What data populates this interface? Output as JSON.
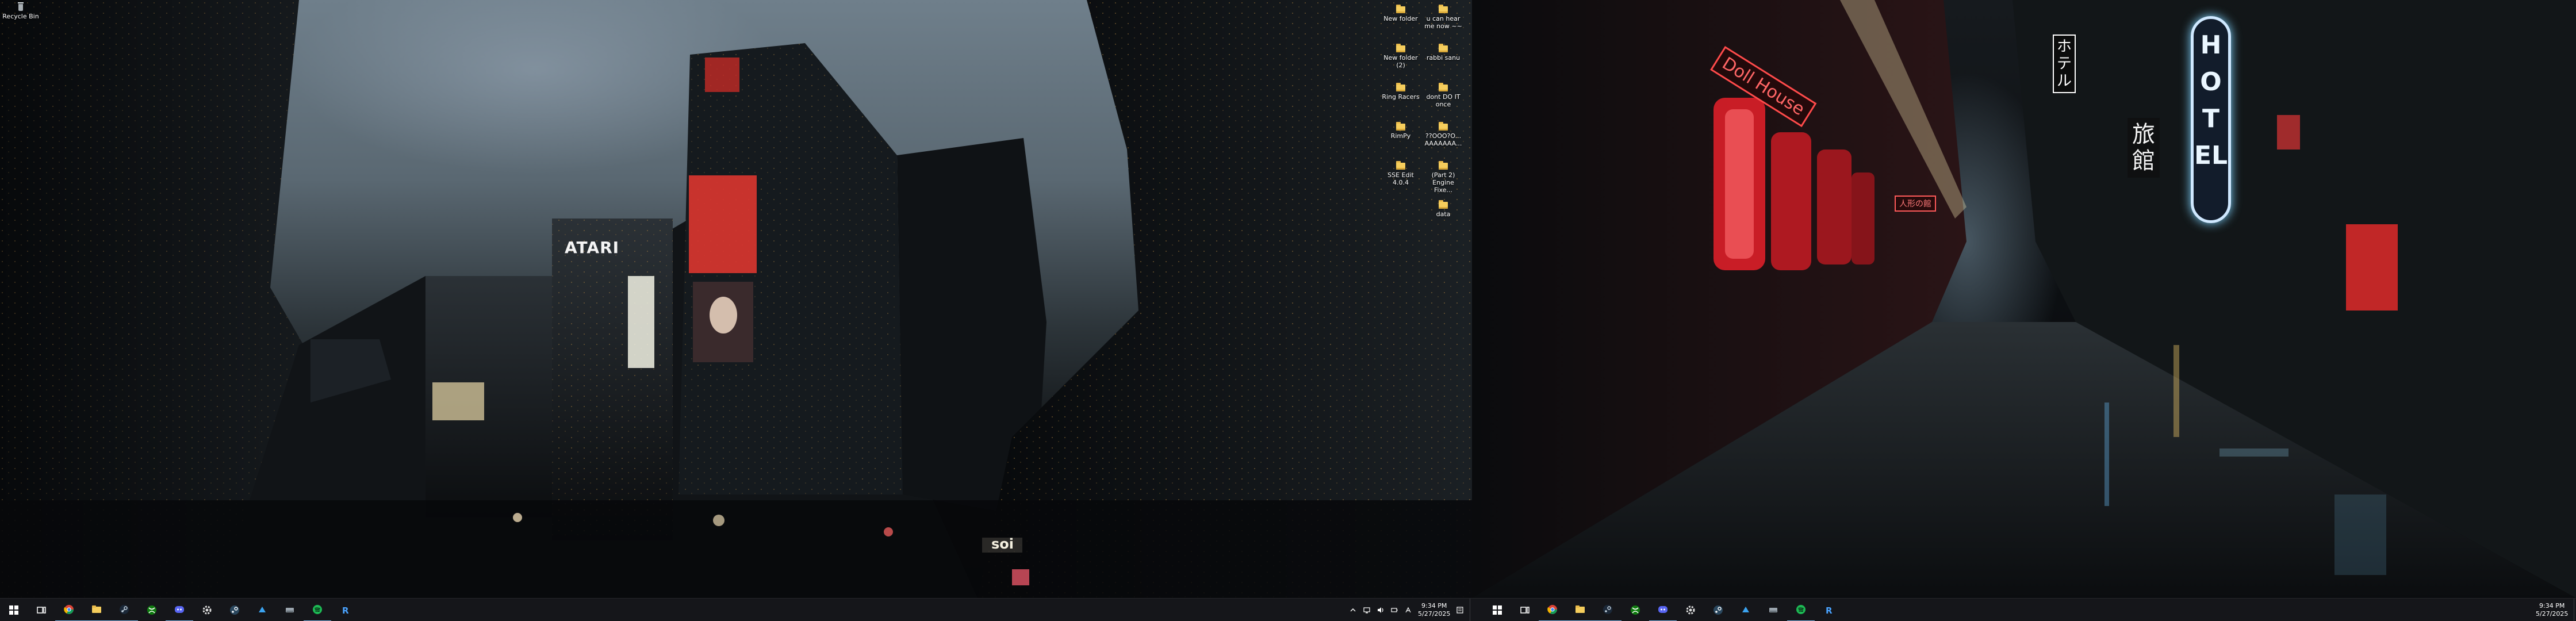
{
  "desktop_left": {
    "recycle_bin": "Recycle Bin",
    "icons": [
      {
        "label": "New folder",
        "type": "folder"
      },
      {
        "label": "u can hear me now ~~",
        "type": "folder"
      },
      {
        "label": "New folder (2)",
        "type": "folder"
      },
      {
        "label": "rabbi sanu",
        "type": "folder"
      },
      {
        "label": "Ring Racers",
        "type": "folder"
      },
      {
        "label": "dont DO IT once",
        "type": "folder"
      },
      {
        "label": "RimPy",
        "type": "folder"
      },
      {
        "label": "??OOO?O... AAAAAAA...",
        "type": "folder"
      },
      {
        "label": "SSE Edit 4.0.4",
        "type": "folder"
      },
      {
        "label": "(Part 2) Engine Fixe...",
        "type": "folder"
      },
      {
        "label": "",
        "type": "none"
      },
      {
        "label": "data",
        "type": "folder"
      }
    ]
  },
  "wallpaper_left": {
    "billboard_brand": "ATARI",
    "billboard_text": "soi"
  },
  "wallpaper_right": {
    "sign_doll_house": "Doll House",
    "sign_hotel": "HOTEL",
    "sign_hotel_jp": "ホテル",
    "sign_ryokan": "旅館",
    "sign_small": "人形の館"
  },
  "taskbar_left": {
    "apps": [
      {
        "name": "start-button",
        "icon": "windows-icon",
        "active": false
      },
      {
        "name": "task-view-button",
        "icon": "task-view-icon",
        "active": false
      },
      {
        "name": "taskbar-chrome",
        "icon": "chrome-icon",
        "active": true
      },
      {
        "name": "taskbar-file-explorer",
        "icon": "folder-icon",
        "active": true
      },
      {
        "name": "taskbar-steam",
        "icon": "steam-icon",
        "active": true
      },
      {
        "name": "taskbar-xbox",
        "icon": "xbox-icon",
        "active": false
      },
      {
        "name": "taskbar-discord",
        "icon": "discord-icon",
        "active": true
      },
      {
        "name": "taskbar-settings",
        "icon": "gear-icon",
        "active": false
      },
      {
        "name": "taskbar-steam-2",
        "icon": "steam-icon",
        "active": false
      },
      {
        "name": "taskbar-app-blue",
        "icon": "app-icon",
        "active": false
      },
      {
        "name": "taskbar-app-drive",
        "icon": "drive-icon",
        "active": false
      },
      {
        "name": "taskbar-spotify",
        "icon": "spotify-icon",
        "active": true
      },
      {
        "name": "taskbar-app-r",
        "icon": "r-icon",
        "active": false
      }
    ],
    "tray_icons": [
      "chevron-up-icon",
      "network-icon",
      "volume-icon",
      "battery-icon",
      "language-icon"
    ],
    "time": "9:34 PM",
    "date": "5/27/2025"
  },
  "taskbar_right": {
    "time": "9:34 PM",
    "date": "5/27/2025"
  },
  "colors": {
    "taskbar_bg": "#15161a",
    "accent": "#7fb2e5",
    "neon_red": "#ff3b3b",
    "neon_blue": "#7fd4ff"
  }
}
